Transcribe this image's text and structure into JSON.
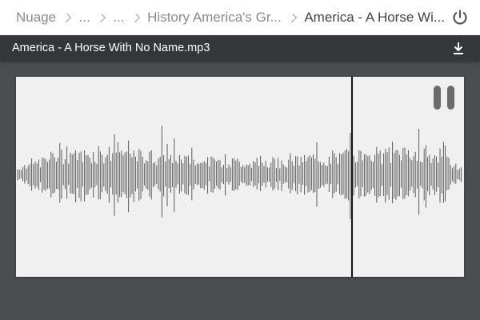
{
  "breadcrumb": {
    "items": [
      {
        "label": "Nuage"
      },
      {
        "label": "..."
      },
      {
        "label": "..."
      },
      {
        "label": "History America's Gr..."
      },
      {
        "label": "America - A Horse Wi..."
      }
    ]
  },
  "header": {
    "power_icon": "power-icon"
  },
  "file": {
    "title": "America - A Horse With No Name.mp3",
    "download_icon": "download-icon"
  },
  "player": {
    "state": "playing",
    "control_icon": "pause-icon",
    "progress": 0.75,
    "colors": {
      "background": "#f0f0f0",
      "waveform": "#5a5a5a",
      "playhead": "#111111"
    }
  }
}
